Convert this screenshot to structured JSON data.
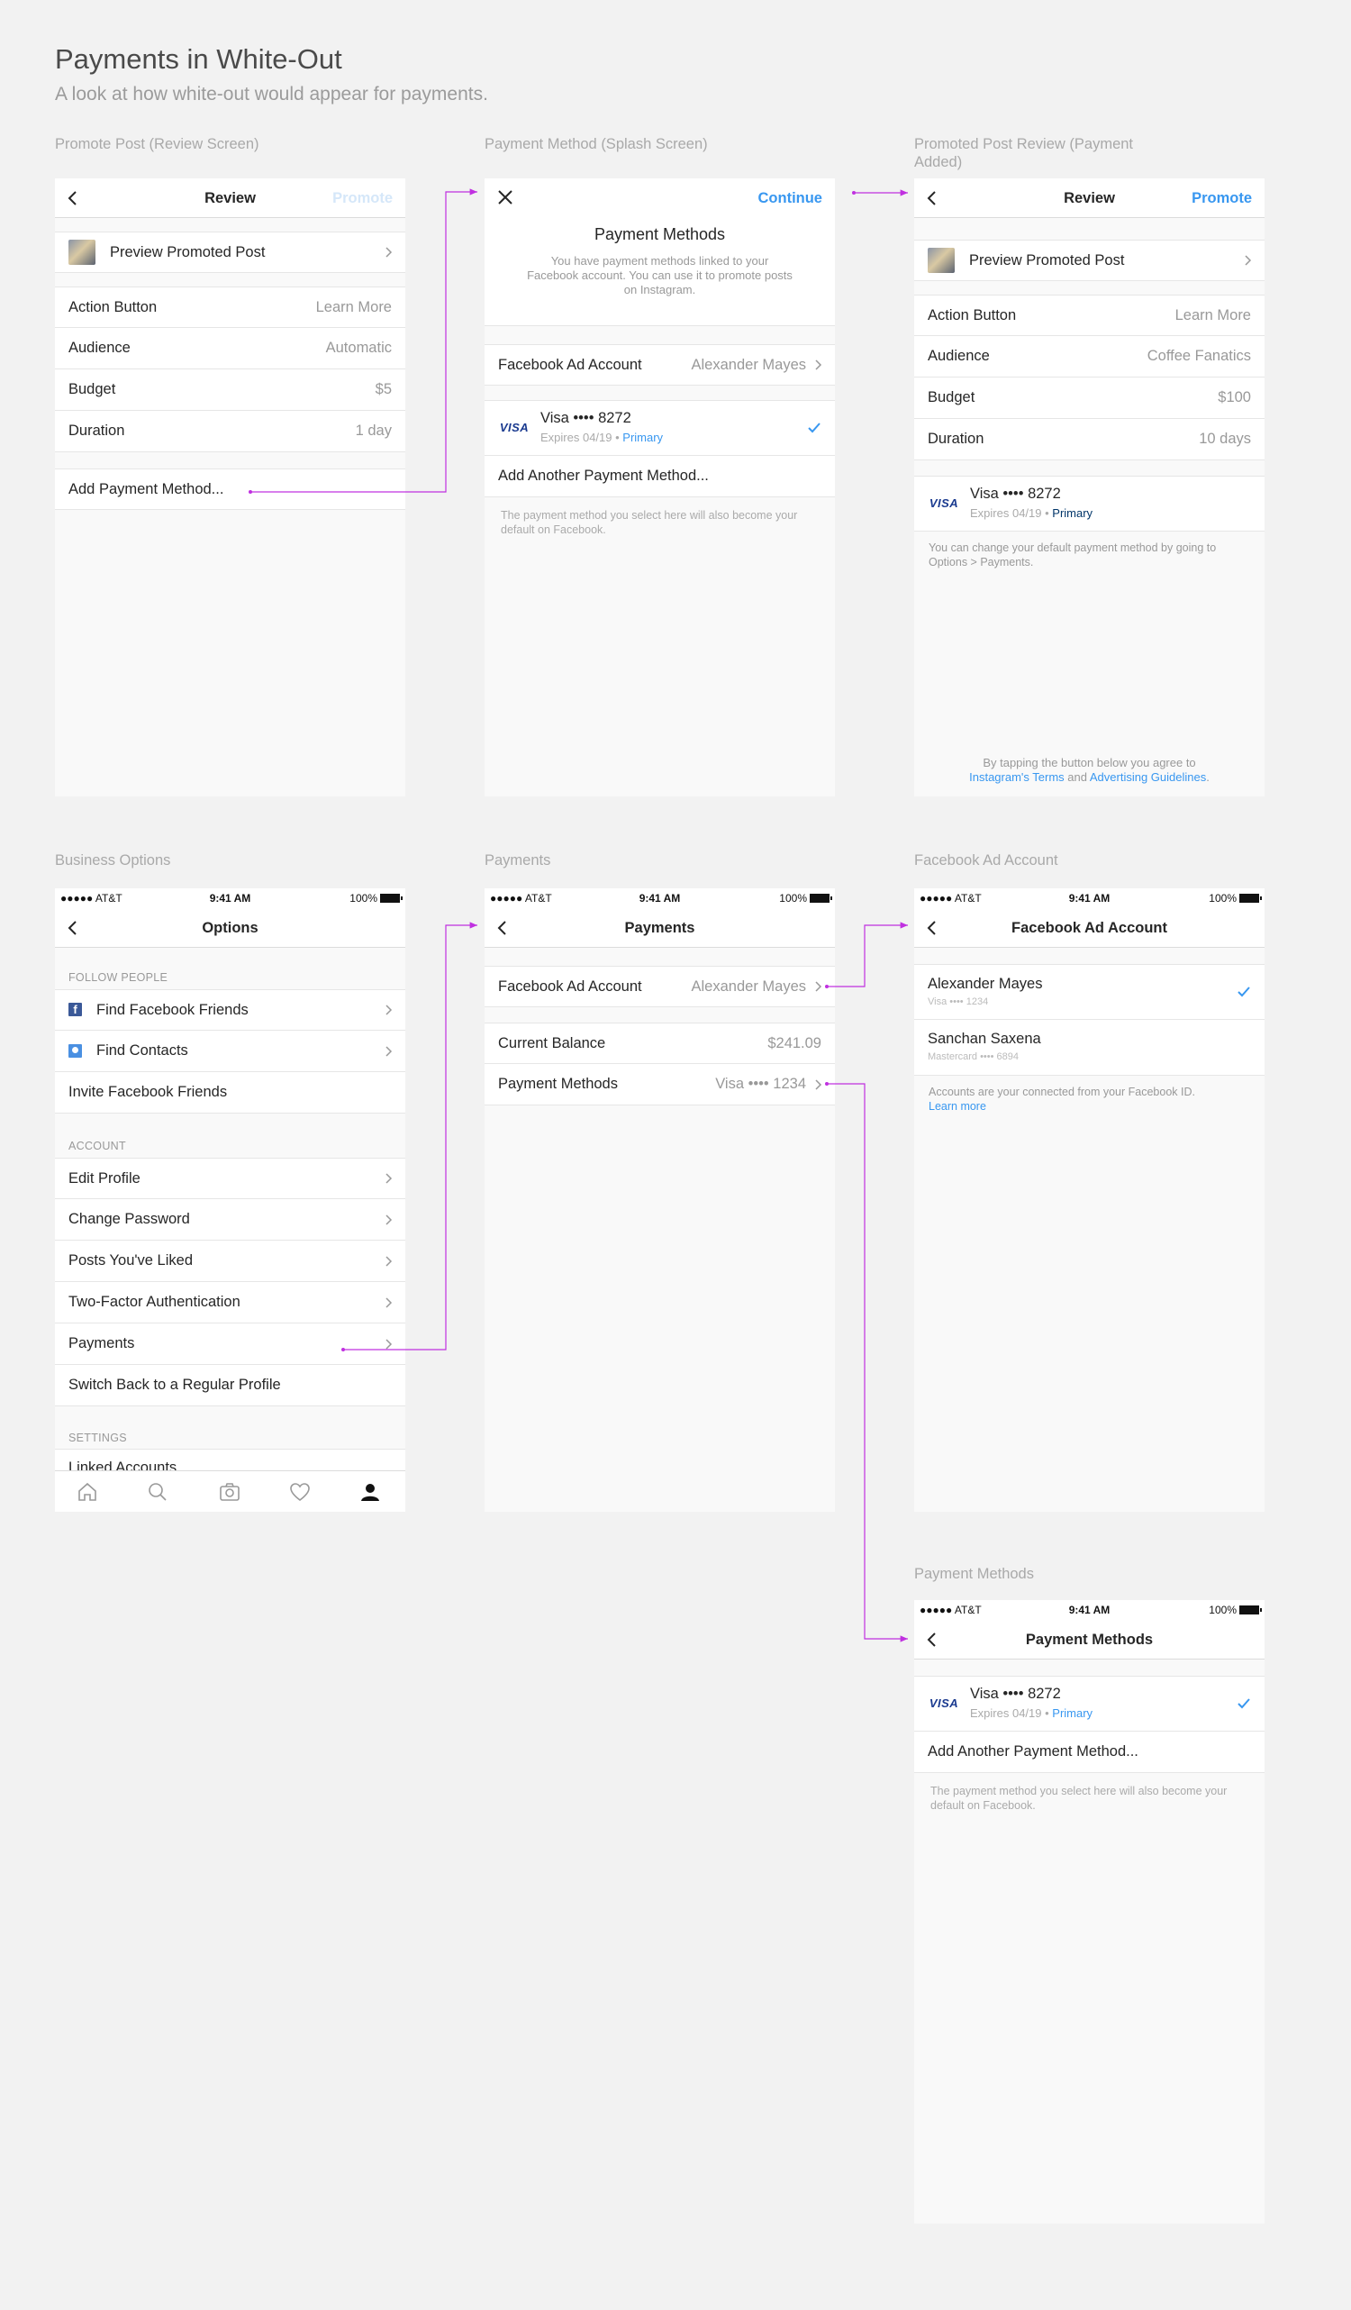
{
  "page": {
    "title": "Payments in White-Out",
    "subtitle": "A look at how white-out would appear for payments."
  },
  "colors": {
    "accent": "#3897f0",
    "connector": "#c030e0",
    "background": "#f2f2f2"
  },
  "status_bar": {
    "carrier": "●●●●● AT&T",
    "time": "9:41 AM",
    "battery": "100%"
  },
  "promote_review": {
    "caption": "Promote Post (Review Screen)",
    "nav_title": "Review",
    "nav_action": "Promote",
    "preview": "Preview Promoted Post",
    "rows": [
      {
        "label": "Action Button",
        "value": "Learn More"
      },
      {
        "label": "Audience",
        "value": "Automatic"
      },
      {
        "label": "Budget",
        "value": "$5"
      },
      {
        "label": "Duration",
        "value": "1 day"
      }
    ],
    "add_payment": "Add Payment Method..."
  },
  "splash": {
    "caption": "Payment Method (Splash Screen)",
    "nav_action": "Continue",
    "heading": "Payment Methods",
    "description": "You have payment methods linked to your Facebook account. You can use it to promote posts on Instagram.",
    "fb_account_label": "Facebook Ad Account",
    "fb_account_value": "Alexander Mayes",
    "card_brand": "VISA",
    "card_title": "Visa •••• 8272",
    "card_expires": "Expires 04/19 • ",
    "card_primary": "Primary",
    "add_another": "Add Another Payment Method...",
    "note": "The payment method you select here will also become your default on Facebook."
  },
  "promoted_review": {
    "caption": "Promoted Post Review (Payment Added)",
    "nav_title": "Review",
    "nav_action": "Promote",
    "preview": "Preview Promoted Post",
    "rows": [
      {
        "label": "Action Button",
        "value": "Learn More"
      },
      {
        "label": "Audience",
        "value": "Coffee Fanatics"
      },
      {
        "label": "Budget",
        "value": "$100"
      },
      {
        "label": "Duration",
        "value": "10 days"
      }
    ],
    "card_brand": "VISA",
    "card_title": "Visa •••• 8272",
    "card_expires": "Expires 04/19 • ",
    "card_primary": "Primary",
    "note": "You can change your default payment method by going to Options > Payments.",
    "terms_prefix": "By tapping the button below you agree to",
    "terms_link1": "Instagram's Terms",
    "terms_and": " and ",
    "terms_link2": "Advertising Guidelines",
    "terms_end": "."
  },
  "options": {
    "caption": "Business Options",
    "nav_title": "Options",
    "follow_header": "FOLLOW PEOPLE",
    "find_fb": "Find Facebook Friends",
    "find_contacts": "Find Contacts",
    "invite_fb": "Invite Facebook Friends",
    "account_header": "ACCOUNT",
    "account_items": [
      "Edit Profile",
      "Change Password",
      "Posts You've Liked",
      "Two-Factor Authentication",
      "Payments"
    ],
    "switch_back": "Switch Back to a Regular Profile",
    "settings_header": "SETTINGS",
    "settings_partial": "Linked Accounts"
  },
  "payments": {
    "caption": "Payments",
    "nav_title": "Payments",
    "fb_account_label": "Facebook Ad Account",
    "fb_account_value": "Alexander Mayes",
    "balance_label": "Current Balance",
    "balance_value": "$241.09",
    "methods_label": "Payment Methods",
    "methods_value": "Visa •••• 1234"
  },
  "fb_ad_account": {
    "caption": "Facebook Ad Account",
    "nav_title": "Facebook Ad Account",
    "accounts": [
      {
        "name": "Alexander Mayes",
        "detail": "Visa •••• 1234"
      },
      {
        "name": "Sanchan Saxena",
        "detail": "Mastercard •••• 6894"
      }
    ],
    "note": "Accounts are your connected from your Facebook ID.",
    "learn_more": "Learn more"
  },
  "payment_methods": {
    "caption": "Payment Methods",
    "nav_title": "Payment Methods",
    "card_brand": "VISA",
    "card_title": "Visa •••• 8272",
    "card_expires": "Expires 04/19 • ",
    "card_primary": "Primary",
    "add_another": "Add Another Payment Method...",
    "note": "The payment method you select here will also become your default on Facebook."
  }
}
